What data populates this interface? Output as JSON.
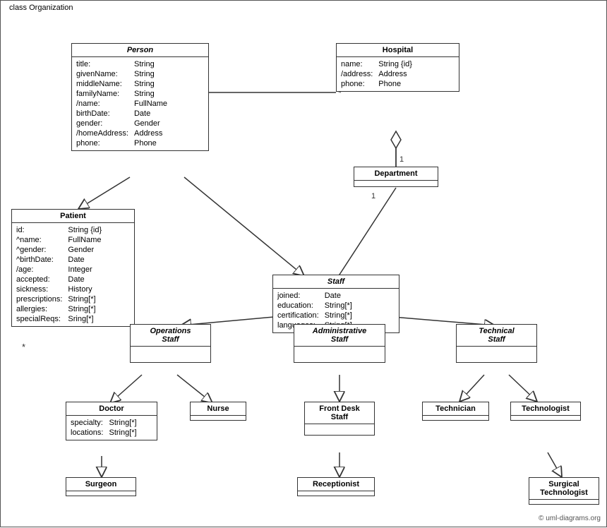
{
  "diagram": {
    "title": "class Organization",
    "copyright": "© uml-diagrams.org",
    "classes": {
      "person": {
        "name": "Person",
        "italic": true,
        "attributes": [
          [
            "title:",
            "String"
          ],
          [
            "givenName:",
            "String"
          ],
          [
            "middleName:",
            "String"
          ],
          [
            "familyName:",
            "String"
          ],
          [
            "/name:",
            "FullName"
          ],
          [
            "birthDate:",
            "Date"
          ],
          [
            "gender:",
            "Gender"
          ],
          [
            "/homeAddress:",
            "Address"
          ],
          [
            "phone:",
            "Phone"
          ]
        ]
      },
      "hospital": {
        "name": "Hospital",
        "italic": false,
        "attributes": [
          [
            "name:",
            "String {id}"
          ],
          [
            "/address:",
            "Address"
          ],
          [
            "phone:",
            "Phone"
          ]
        ]
      },
      "patient": {
        "name": "Patient",
        "italic": false,
        "attributes": [
          [
            "id:",
            "String {id}"
          ],
          [
            "^name:",
            "FullName"
          ],
          [
            "^gender:",
            "Gender"
          ],
          [
            "^birthDate:",
            "Date"
          ],
          [
            "/age:",
            "Integer"
          ],
          [
            "accepted:",
            "Date"
          ],
          [
            "sickness:",
            "History"
          ],
          [
            "prescriptions:",
            "String[*]"
          ],
          [
            "allergies:",
            "String[*]"
          ],
          [
            "specialReqs:",
            "Sring[*]"
          ]
        ]
      },
      "department": {
        "name": "Department",
        "italic": false,
        "attributes": []
      },
      "staff": {
        "name": "Staff",
        "italic": true,
        "attributes": [
          [
            "joined:",
            "Date"
          ],
          [
            "education:",
            "String[*]"
          ],
          [
            "certification:",
            "String[*]"
          ],
          [
            "languages:",
            "String[*]"
          ]
        ]
      },
      "operations_staff": {
        "name": "Operations\nStaff",
        "italic": true,
        "attributes": []
      },
      "administrative_staff": {
        "name": "Administrative\nStaff",
        "italic": true,
        "attributes": []
      },
      "technical_staff": {
        "name": "Technical\nStaff",
        "italic": true,
        "attributes": []
      },
      "doctor": {
        "name": "Doctor",
        "italic": false,
        "attributes": [
          [
            "specialty:",
            "String[*]"
          ],
          [
            "locations:",
            "String[*]"
          ]
        ]
      },
      "nurse": {
        "name": "Nurse",
        "italic": false,
        "attributes": []
      },
      "front_desk_staff": {
        "name": "Front Desk\nStaff",
        "italic": false,
        "attributes": []
      },
      "technician": {
        "name": "Technician",
        "italic": false,
        "attributes": []
      },
      "technologist": {
        "name": "Technologist",
        "italic": false,
        "attributes": []
      },
      "surgeon": {
        "name": "Surgeon",
        "italic": false,
        "attributes": []
      },
      "receptionist": {
        "name": "Receptionist",
        "italic": false,
        "attributes": []
      },
      "surgical_technologist": {
        "name": "Surgical\nTechnologist",
        "italic": false,
        "attributes": []
      }
    }
  }
}
